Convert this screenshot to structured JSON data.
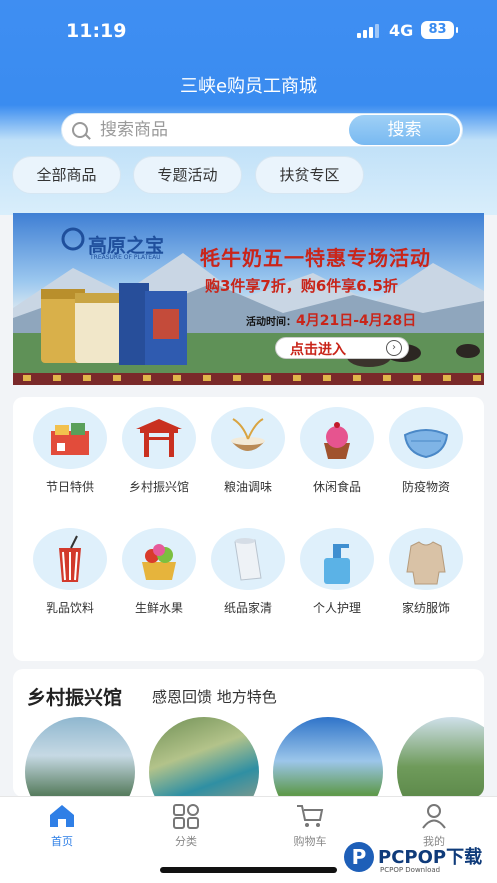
{
  "status": {
    "time": "11:19",
    "network": "4G",
    "battery": "83"
  },
  "header": {
    "title": "三峡e购员工商城"
  },
  "search": {
    "placeholder": "搜索商品",
    "button": "搜索"
  },
  "tabs": [
    "全部商品",
    "专题活动",
    "扶贫专区"
  ],
  "banner": {
    "logo_text": "高原之宝",
    "logo_sub": "TREASURE OF PLATEAU",
    "headline": "牦牛奶五一特惠专场活动",
    "offer": "购3件享7折，购6件享6.5折",
    "time_label": "活动时间：",
    "time_value": "4月21日-4月28日",
    "cta": "点击进入"
  },
  "categories": [
    {
      "label": "节日特供",
      "icon": "gift-box-icon"
    },
    {
      "label": "乡村振兴馆",
      "icon": "archway-icon"
    },
    {
      "label": "粮油调味",
      "icon": "rice-bowl-icon"
    },
    {
      "label": "休闲食品",
      "icon": "cupcake-icon"
    },
    {
      "label": "防疫物资",
      "icon": "face-mask-icon"
    },
    {
      "label": "乳品饮料",
      "icon": "drink-cup-icon"
    },
    {
      "label": "生鲜水果",
      "icon": "fruit-basket-icon"
    },
    {
      "label": "纸品家清",
      "icon": "tissue-roll-icon"
    },
    {
      "label": "个人护理",
      "icon": "pump-bottle-icon"
    },
    {
      "label": "家纺服饰",
      "icon": "sweater-icon"
    }
  ],
  "section": {
    "title": "乡村振兴馆",
    "subtitle": "感恩回馈 地方特色"
  },
  "nav": [
    {
      "label": "首页",
      "icon": "home-icon",
      "active": true
    },
    {
      "label": "分类",
      "icon": "grid-icon",
      "active": false
    },
    {
      "label": "购物车",
      "icon": "cart-icon",
      "active": false
    },
    {
      "label": "我的",
      "icon": "user-icon",
      "active": false
    }
  ],
  "watermark": {
    "brand": "PCPOP下载",
    "sub": "PCPOP Download"
  },
  "colors": {
    "primary": "#3a8cf0",
    "accent_red": "#d12d1c",
    "nav_active": "#2f7fe6"
  }
}
